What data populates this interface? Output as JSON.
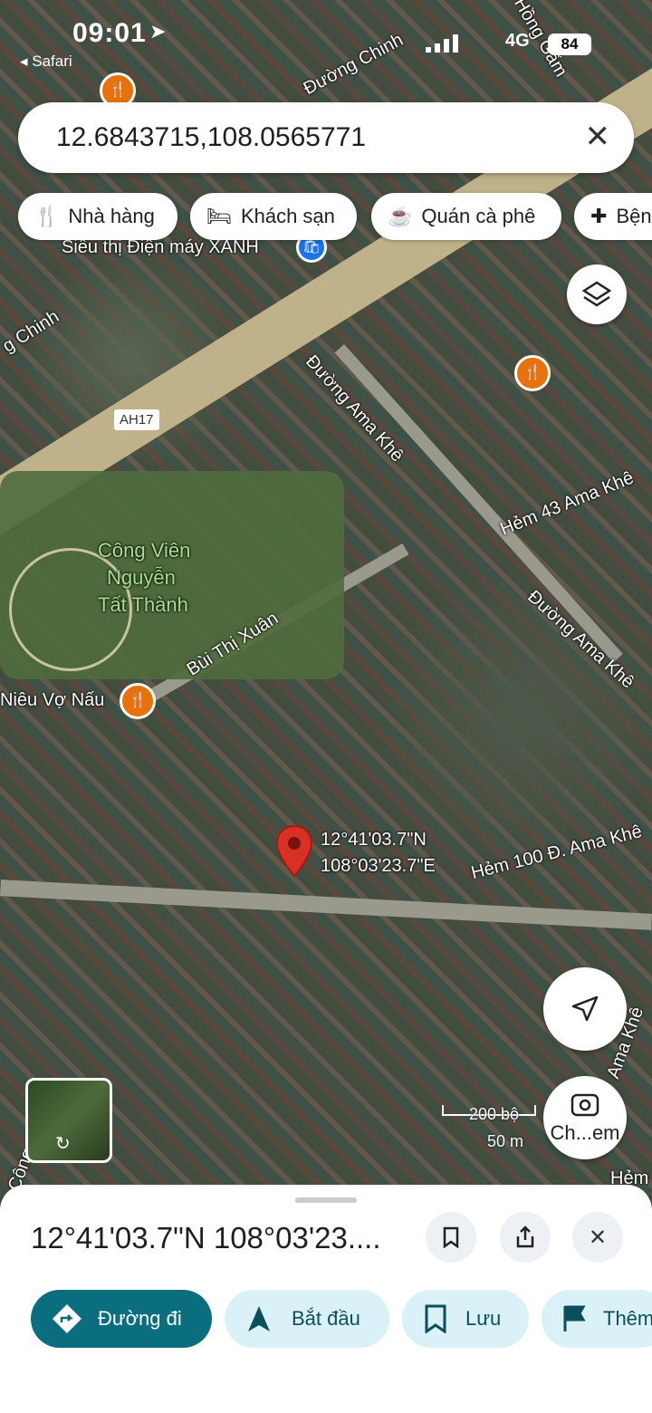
{
  "status_bar": {
    "time": "09:01",
    "back_label": "◂ Safari",
    "network": "4G",
    "battery": "84"
  },
  "search": {
    "query": "12.6843715,108.0565771"
  },
  "chips": [
    {
      "label": "Nhà hàng",
      "icon": "fork-knife-icon"
    },
    {
      "label": "Khách sạn",
      "icon": "bed-icon"
    },
    {
      "label": "Quán cà phê",
      "icon": "coffee-icon"
    },
    {
      "label": "Bệnh",
      "icon": "hospital-icon"
    }
  ],
  "map_labels": {
    "duong_chinh_top": "Đường Chinh",
    "hong_gam": "Hồng Gấm",
    "dien_may": "Siêu thị Điện máy XANH",
    "chinh_left": "g Chinh",
    "ama_khe_1": "Đường Ama Khê",
    "hem_43": "Hẻm 43 Ama Khê",
    "ama_khe_2": "Đường Ama Khê",
    "park_line1": "Công Viên",
    "park_line2": "Nguyễn",
    "park_line3": "Tất Thành",
    "bui_thi_xuan": "Bùi Thị Xuân",
    "nieu_vo_nau": "Niêu Vợ Nấu",
    "hem_100": "Hẻm 100 Đ. Ama Khê",
    "ama_khe_3": "Ama Khê",
    "hem_right": "Hẻm",
    "cong_left": "Công",
    "highway": "AH17",
    "pin_lat": "12°41'03.7\"N",
    "pin_lng": "108°03'23.7\"E",
    "scale_ft": "200 bộ",
    "scale_m": "50 m"
  },
  "camera_label": "Ch...em",
  "sheet": {
    "title": "12°41'03.7\"N 108°03'23....",
    "actions": [
      {
        "label": "Đường đi"
      },
      {
        "label": "Bắt đầu"
      },
      {
        "label": "Lưu"
      },
      {
        "label": "Thêm"
      }
    ]
  },
  "colors": {
    "accent": "#0b6e7f",
    "chip_bg": "#d9f1f7",
    "pin": "#d93025",
    "poi": "#e8710a"
  }
}
